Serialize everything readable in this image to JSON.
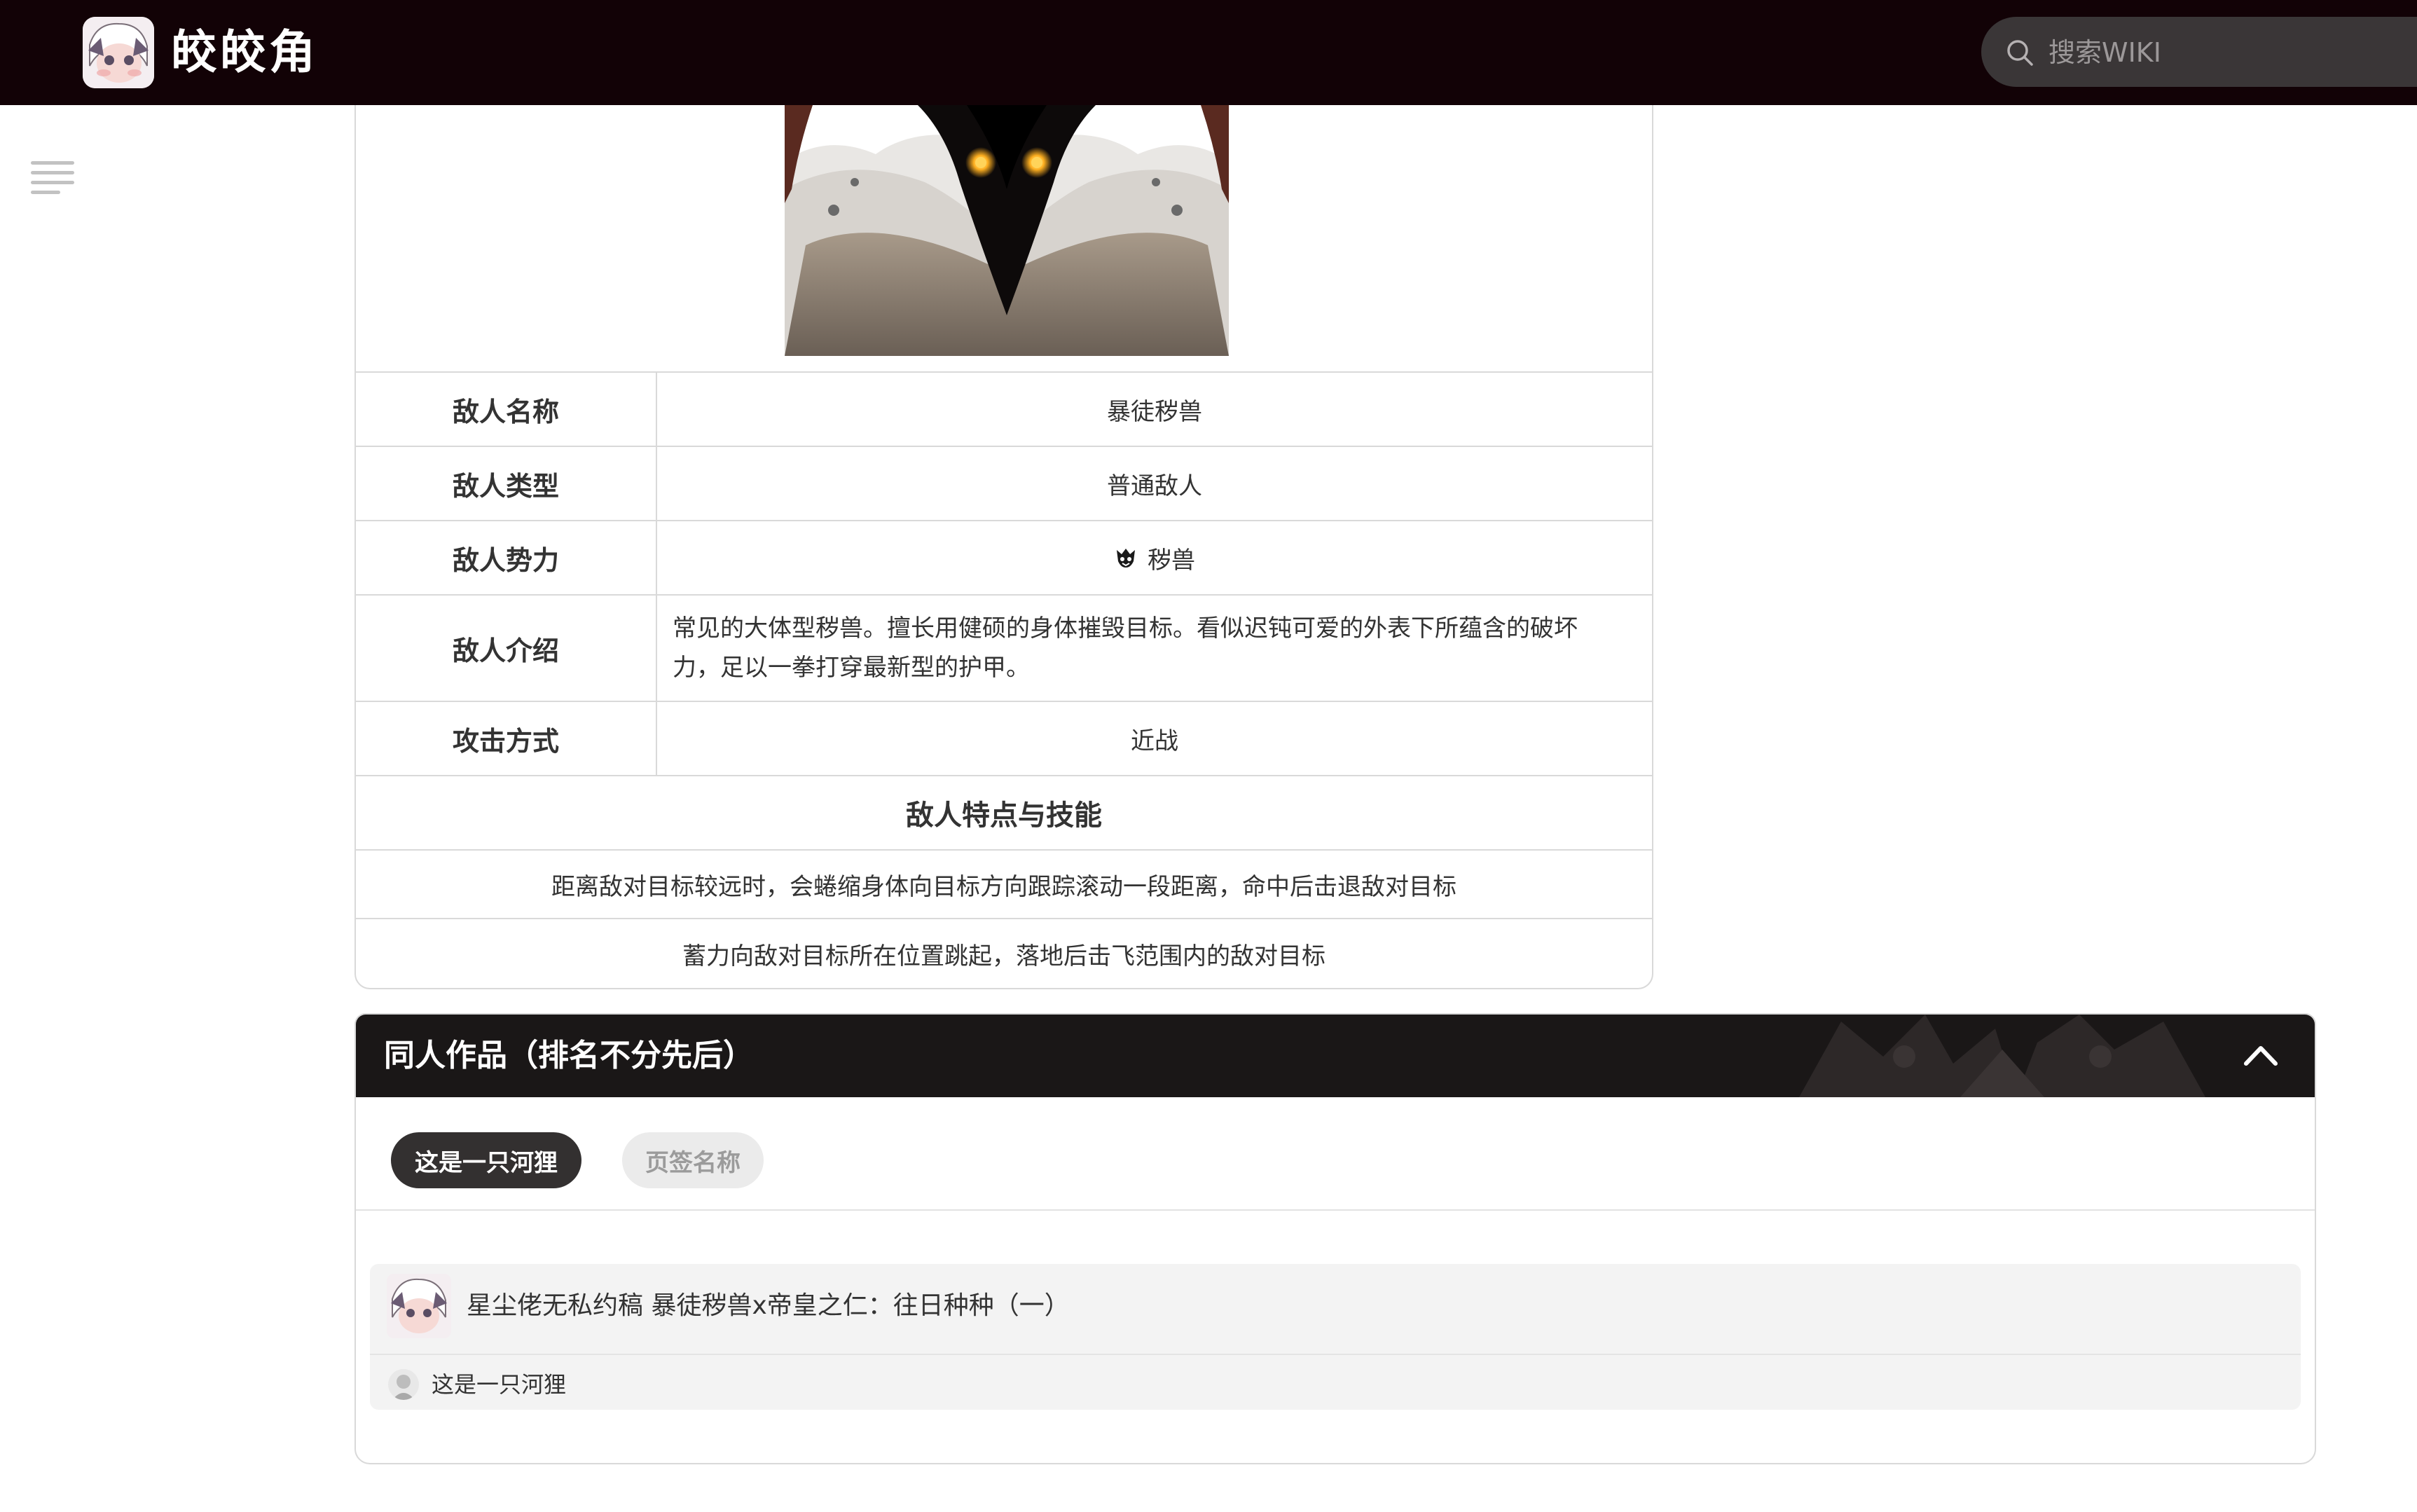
{
  "header": {
    "site_name": "皎皎角",
    "search_placeholder": "搜索WIKI"
  },
  "enemy_table": {
    "rows": [
      {
        "label": "敌人名称",
        "value": "暴徒秽兽"
      },
      {
        "label": "敌人类型",
        "value": "普通敌人"
      },
      {
        "label": "敌人势力",
        "value": "秽兽"
      },
      {
        "label": "敌人介绍",
        "value": "常见的大体型秽兽。擅长用健硕的身体摧毁目标。看似迟钝可爱的外表下所蕴含的破坏力，足以一拳打穿最新型的护甲。"
      },
      {
        "label": "攻击方式",
        "value": "近战"
      }
    ],
    "skills_heading": "敌人特点与技能",
    "skills": [
      "距离敌对目标较远时，会蜷缩身体向目标方向跟踪滚动一段距离，命中后击退敌对目标",
      "蓄力向敌对目标所在位置跳起，落地后击飞范围内的敌对目标"
    ]
  },
  "fan_works": {
    "title": "同人作品（排名不分先后）",
    "tabs": [
      {
        "label": "这是一只河狸",
        "active": true
      },
      {
        "label": "页签名称",
        "active": false
      }
    ],
    "items": [
      {
        "title": "星尘佬无私约稿 暴徒秽兽x帝皇之仁：往日种种（一）",
        "author": "这是一只河狸"
      }
    ]
  },
  "colors": {
    "topbar": "#120206",
    "section_header": "#1a1717",
    "active_tab": "#333030",
    "accent_eyes": "#ffb020"
  }
}
